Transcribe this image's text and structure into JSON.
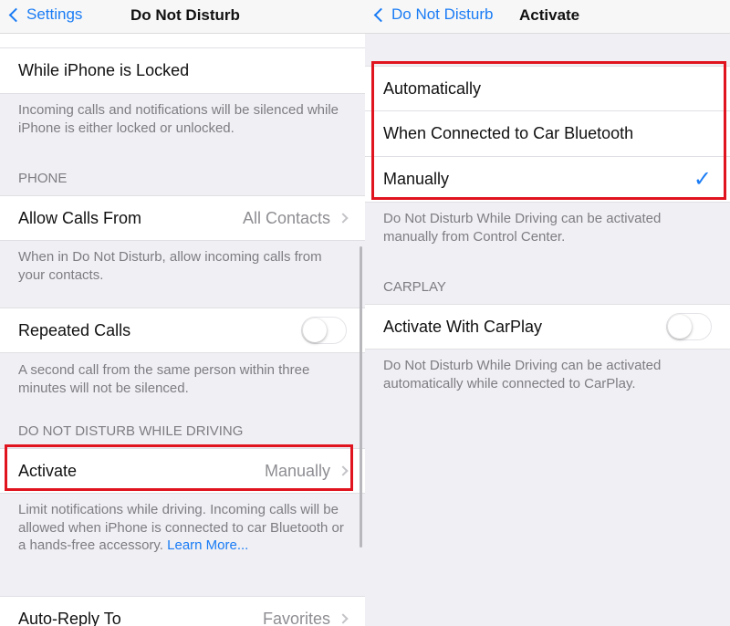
{
  "left": {
    "nav": {
      "back_label": "Settings",
      "title": "Do Not Disturb"
    },
    "locked_row": "While iPhone is Locked",
    "locked_footer": "Incoming calls and notifications will be silenced while iPhone is either locked or unlocked.",
    "phone_header": "PHONE",
    "allow_calls": {
      "label": "Allow Calls From",
      "value": "All Contacts"
    },
    "allow_footer": "When in Do Not Disturb, allow incoming calls from your contacts.",
    "repeated": {
      "label": "Repeated Calls",
      "on": false
    },
    "repeated_footer": "A second call from the same person within three minutes will not be silenced.",
    "driving_header": "DO NOT DISTURB WHILE DRIVING",
    "activate": {
      "label": "Activate",
      "value": "Manually"
    },
    "activate_footer": "Limit notifications while driving. Incoming calls will be allowed when iPhone is connected to car Bluetooth or a hands-free accessory.",
    "learn_more": "Learn More...",
    "auto_reply": {
      "label": "Auto-Reply To",
      "value": "Favorites"
    }
  },
  "right": {
    "nav": {
      "back_label": "Do Not Disturb",
      "title": "Activate"
    },
    "options": [
      "Automatically",
      "When Connected to Car Bluetooth",
      "Manually"
    ],
    "selected": "Manually",
    "options_footer": "Do Not Disturb While Driving can be activated manually from Control Center.",
    "carplay_header": "CARPLAY",
    "carplay": {
      "label": "Activate With CarPlay",
      "on": false
    },
    "carplay_footer": "Do Not Disturb While Driving can be activated automatically while connected to CarPlay."
  },
  "colors": {
    "accent": "#1a7cf5",
    "highlight": "#e0141e"
  }
}
